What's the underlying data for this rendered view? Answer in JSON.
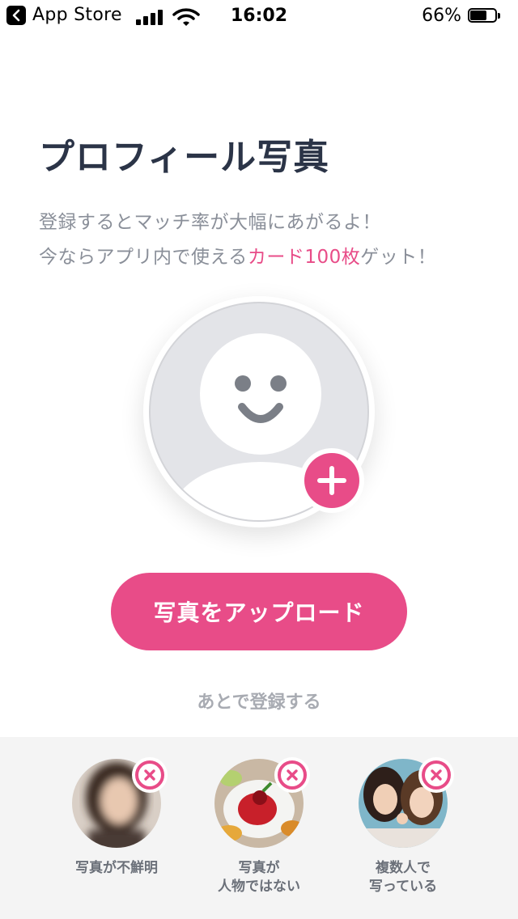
{
  "status_bar": {
    "back_label": "App Store",
    "time": "16:02",
    "battery_percent": "66%",
    "battery_level": 0.66
  },
  "page": {
    "title": "プロフィール写真",
    "description_line1": "登録するとマッチ率が大幅にあがるよ！",
    "description_line2_prefix": "今ならアプリ内で使える",
    "description_line2_highlight": "カード100枚",
    "description_line2_suffix": "ゲット！"
  },
  "buttons": {
    "upload_label": "写真をアップロード",
    "later_label": "あとで登録する"
  },
  "bad_examples": [
    {
      "caption": "写真が不鮮明",
      "icon": "blurred-woman-photo"
    },
    {
      "caption": "写真が\n人物ではない",
      "icon": "food-dessert-photo"
    },
    {
      "caption": "複数人で\n写っている",
      "icon": "group-women-photo"
    }
  ],
  "colors": {
    "accent": "#e84c88",
    "title": "#2b3447",
    "text_muted": "#8a8f99",
    "panel_bg": "#f4f4f4"
  }
}
